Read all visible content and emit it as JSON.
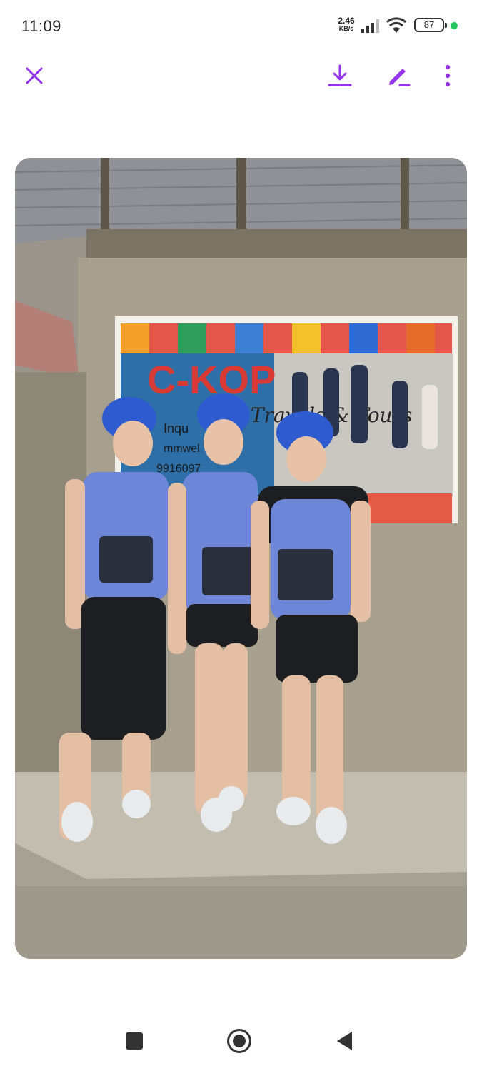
{
  "status_bar": {
    "time": "11:09",
    "net_speed_value": "2.46",
    "net_speed_unit": "KB/s",
    "battery": "87",
    "dot_color": "#22c55e"
  },
  "toolbar": {
    "accent_color": "#9333ea",
    "icons": [
      "close-icon",
      "download-icon",
      "edit-icon",
      "more-vert-icon"
    ]
  },
  "photo": {
    "poster_title": "C-KOP",
    "poster_subtitle": "Travels & Tours",
    "poster_side_text": [
      "Inqu",
      "mmwel",
      "9916097"
    ]
  },
  "nav_bar": {
    "icons": [
      "recents-square-icon",
      "home-circle-icon",
      "back-triangle-icon"
    ]
  }
}
